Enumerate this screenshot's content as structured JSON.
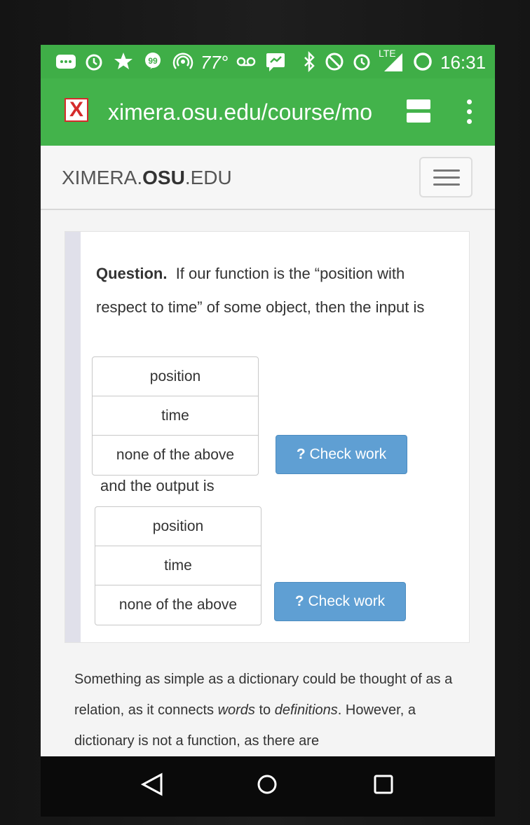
{
  "status_bar": {
    "temperature": "77°",
    "network": "LTE",
    "time": "16:31",
    "icons": [
      "message-icon",
      "alarm-icon",
      "star-icon",
      "hangouts-icon",
      "hotspot-icon",
      "voicemail-icon",
      "chat-icon",
      "bluetooth-icon",
      "blocked-icon",
      "alarm-icon",
      "signal-icon",
      "battery-icon"
    ]
  },
  "browser": {
    "url": "ximera.osu.edu/course/mo",
    "favicon": "X",
    "accent": "#43b34b"
  },
  "site": {
    "brand_prefix": "XIMERA.",
    "brand_bold": "OSU",
    "brand_suffix": ".EDU"
  },
  "question": {
    "label": "Question.",
    "text": "If our function is the “position with respect to time” of some object, then the input is",
    "input_choices": [
      "position",
      "time",
      "none of the above"
    ],
    "check_label": "Check work",
    "output_label": "and the output is",
    "output_choices": [
      "position",
      "time",
      "none of the above"
    ],
    "check_label_2": "Check work",
    "button_color": "#5f9fd3"
  },
  "paragraph": {
    "part1": "Something as simple as a dictionary could be thought of as a relation, as it connects ",
    "em1": "words",
    "part2": " to ",
    "em2": "definitions",
    "part3": ". However, a dictionary is not a function, as there are"
  }
}
